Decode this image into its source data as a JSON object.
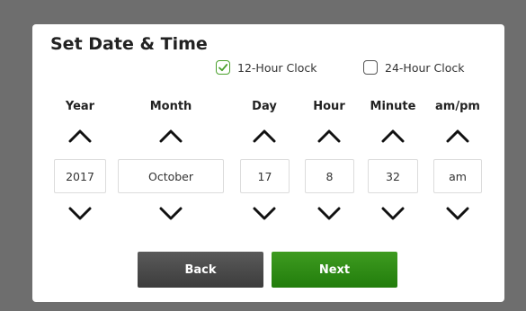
{
  "title": "Set Date & Time",
  "clock_options": {
    "twelve_hour": {
      "label": "12-Hour Clock",
      "checked": true
    },
    "twenty_four_hour": {
      "label": "24-Hour Clock",
      "checked": false
    }
  },
  "columns": [
    {
      "key": "year",
      "header": "Year",
      "value": "2017"
    },
    {
      "key": "month",
      "header": "Month",
      "value": "October"
    },
    {
      "key": "day",
      "header": "Day",
      "value": "17"
    },
    {
      "key": "hour",
      "header": "Hour",
      "value": "8"
    },
    {
      "key": "minute",
      "header": "Minute",
      "value": "32"
    },
    {
      "key": "ampm",
      "header": "am/pm",
      "value": "am"
    }
  ],
  "buttons": {
    "back": "Back",
    "next": "Next"
  },
  "colors": {
    "accent": "#2e8b14",
    "check": "#4aa02c",
    "back_button": "#4a4a4a",
    "backdrop": "#6e6e6e"
  }
}
